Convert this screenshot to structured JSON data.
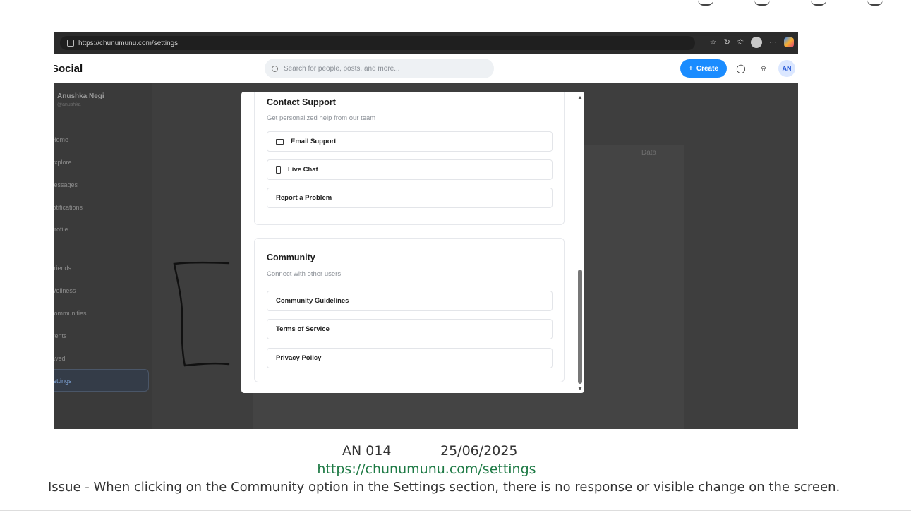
{
  "browser": {
    "url": "https://chunumunu.com/settings"
  },
  "app": {
    "logo": "Social",
    "search_placeholder": "Search for people, posts, and more...",
    "create_label": "Create",
    "avatar_initials": "AN"
  },
  "sidebar": {
    "profile_name": "Anushka Negi",
    "profile_handle": "@anushka",
    "items": [
      {
        "label": "Home"
      },
      {
        "label": "Explore"
      },
      {
        "label": "Messages"
      },
      {
        "label": "Notifications"
      },
      {
        "label": "Profile"
      },
      {
        "label": "Friends"
      },
      {
        "label": "Wellness"
      },
      {
        "label": "Communities"
      },
      {
        "label": "Events"
      },
      {
        "label": "Saved"
      },
      {
        "label": "Settings"
      }
    ]
  },
  "background": {
    "data_label": "Data"
  },
  "modal": {
    "contact": {
      "title": "Contact Support",
      "subtitle": "Get personalized help from our team",
      "options": [
        "Email Support",
        "Live Chat",
        "Report a Problem"
      ]
    },
    "community": {
      "title": "Community",
      "subtitle": "Connect with other users",
      "options": [
        "Community Guidelines",
        "Terms of Service",
        "Privacy Policy"
      ]
    }
  },
  "caption": {
    "id": "AN 014",
    "date": "25/06/2025",
    "link": "https://chunumunu.com/settings",
    "issue": "Issue -  When clicking on the Community option in the Settings section, there is no response or visible change on the screen."
  }
}
